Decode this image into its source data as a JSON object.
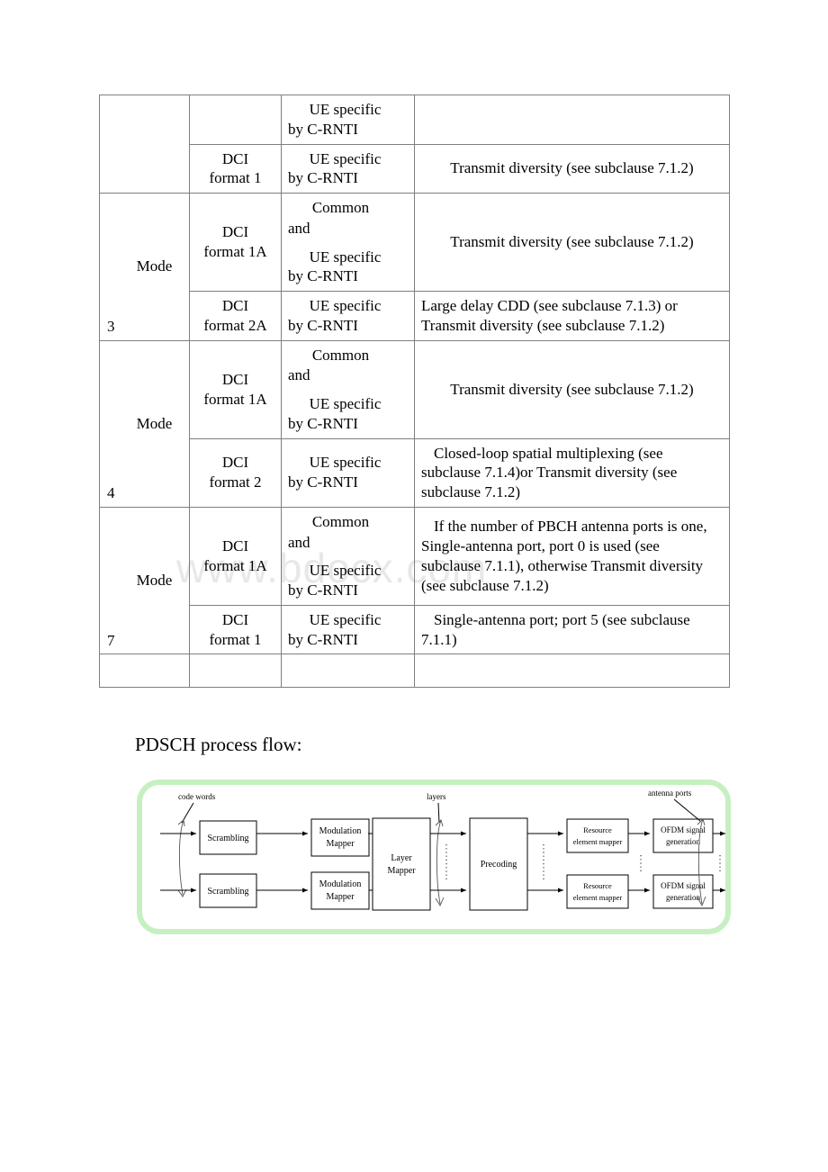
{
  "watermark": {
    "text": "www.bdocx.com"
  },
  "table": {
    "rows": [
      {
        "mode_word": "",
        "mode_num": "",
        "dci_l1": "",
        "dci_l2": "",
        "rnti_type": "ue",
        "rnti_ue": "UE specific",
        "rnti_by": "by C-RNTI",
        "scheme": "",
        "scheme_align": "center"
      },
      {
        "mode_word": "",
        "mode_num": "",
        "dci_l1": "DCI",
        "dci_l2": "format 1",
        "rnti_type": "ue",
        "rnti_ue": "UE specific",
        "rnti_by": "by C-RNTI",
        "scheme": "Transmit diversity (see subclause 7.1.2)",
        "scheme_align": "center"
      },
      {
        "mode_word": "Mode",
        "mode_num": "3",
        "dci_l1": "DCI",
        "dci_l2": "format 1A",
        "rnti_type": "common",
        "rnti_common": "Common",
        "rnti_and": "and",
        "rnti_ue": "UE specific",
        "rnti_by": "by C-RNTI",
        "scheme": "Transmit diversity (see subclause 7.1.2)",
        "scheme_align": "center"
      },
      {
        "mode_word": "",
        "mode_num": "",
        "dci_l1": "DCI",
        "dci_l2": "format 2A",
        "rnti_type": "ue",
        "rnti_ue": "UE specific",
        "rnti_by": "by C-RNTI",
        "scheme": "Large delay CDD (see subclause 7.1.3) or Transmit diversity (see subclause 7.1.2)",
        "scheme_align": "left"
      },
      {
        "mode_word": "Mode",
        "mode_num": "4",
        "dci_l1": "DCI",
        "dci_l2": "format 1A",
        "rnti_type": "common",
        "rnti_common": "Common",
        "rnti_and": "and",
        "rnti_ue": "UE specific",
        "rnti_by": "by C-RNTI",
        "scheme": "Transmit diversity (see subclause 7.1.2)",
        "scheme_align": "center"
      },
      {
        "mode_word": "",
        "mode_num": "",
        "dci_l1": "DCI",
        "dci_l2": "format 2",
        "rnti_type": "ue",
        "rnti_ue": "UE specific",
        "rnti_by": "by C-RNTI",
        "scheme": "Closed-loop spatial multiplexing (see subclause 7.1.4)or Transmit diversity (see subclause 7.1.2)",
        "scheme_align": "left"
      },
      {
        "mode_word": "Mode",
        "mode_num": "7",
        "dci_l1": "DCI",
        "dci_l2": "format 1A",
        "rnti_type": "common",
        "rnti_common": "Common",
        "rnti_and": "and",
        "rnti_ue": "UE specific",
        "rnti_by": "by C-RNTI",
        "scheme": "If the number of PBCH antenna ports is one, Single-antenna port, port 0 is used (see subclause 7.1.1), otherwise Transmit diversity (see subclause 7.1.2)",
        "scheme_align": "left-indent"
      },
      {
        "mode_word": "",
        "mode_num": "",
        "dci_l1": "DCI",
        "dci_l2": "format 1",
        "rnti_type": "ue",
        "rnti_ue": "UE specific",
        "rnti_by": "by C-RNTI",
        "scheme": "Single-antenna port; port 5 (see subclause 7.1.1)",
        "scheme_align": "left-indent"
      }
    ]
  },
  "caption": {
    "text": "PDSCH process flow:"
  },
  "diagram": {
    "border_color": "#c6f0c2",
    "labels": {
      "code_words": "code words",
      "layers": "layers",
      "antenna_ports": "antenna ports"
    },
    "blocks": {
      "scrambling_top": "Scrambling",
      "scrambling_bottom": "Scrambling",
      "modulation_top_l1": "Modulation",
      "modulation_top_l2": "Mapper",
      "modulation_bottom_l1": "Modulation",
      "modulation_bottom_l2": "Mapper",
      "layer_mapper_l1": "Layer",
      "layer_mapper_l2": "Mapper",
      "precoding": "Precoding",
      "re_mapper_top_l1": "Resource",
      "re_mapper_top_l2": "element mapper",
      "re_mapper_bottom_l1": "Resource",
      "re_mapper_bottom_l2": "element mapper",
      "ofdm_top_l1": "OFDM signal",
      "ofdm_top_l2": "generation",
      "ofdm_bottom_l1": "OFDM signal",
      "ofdm_bottom_l2": "generation"
    }
  }
}
